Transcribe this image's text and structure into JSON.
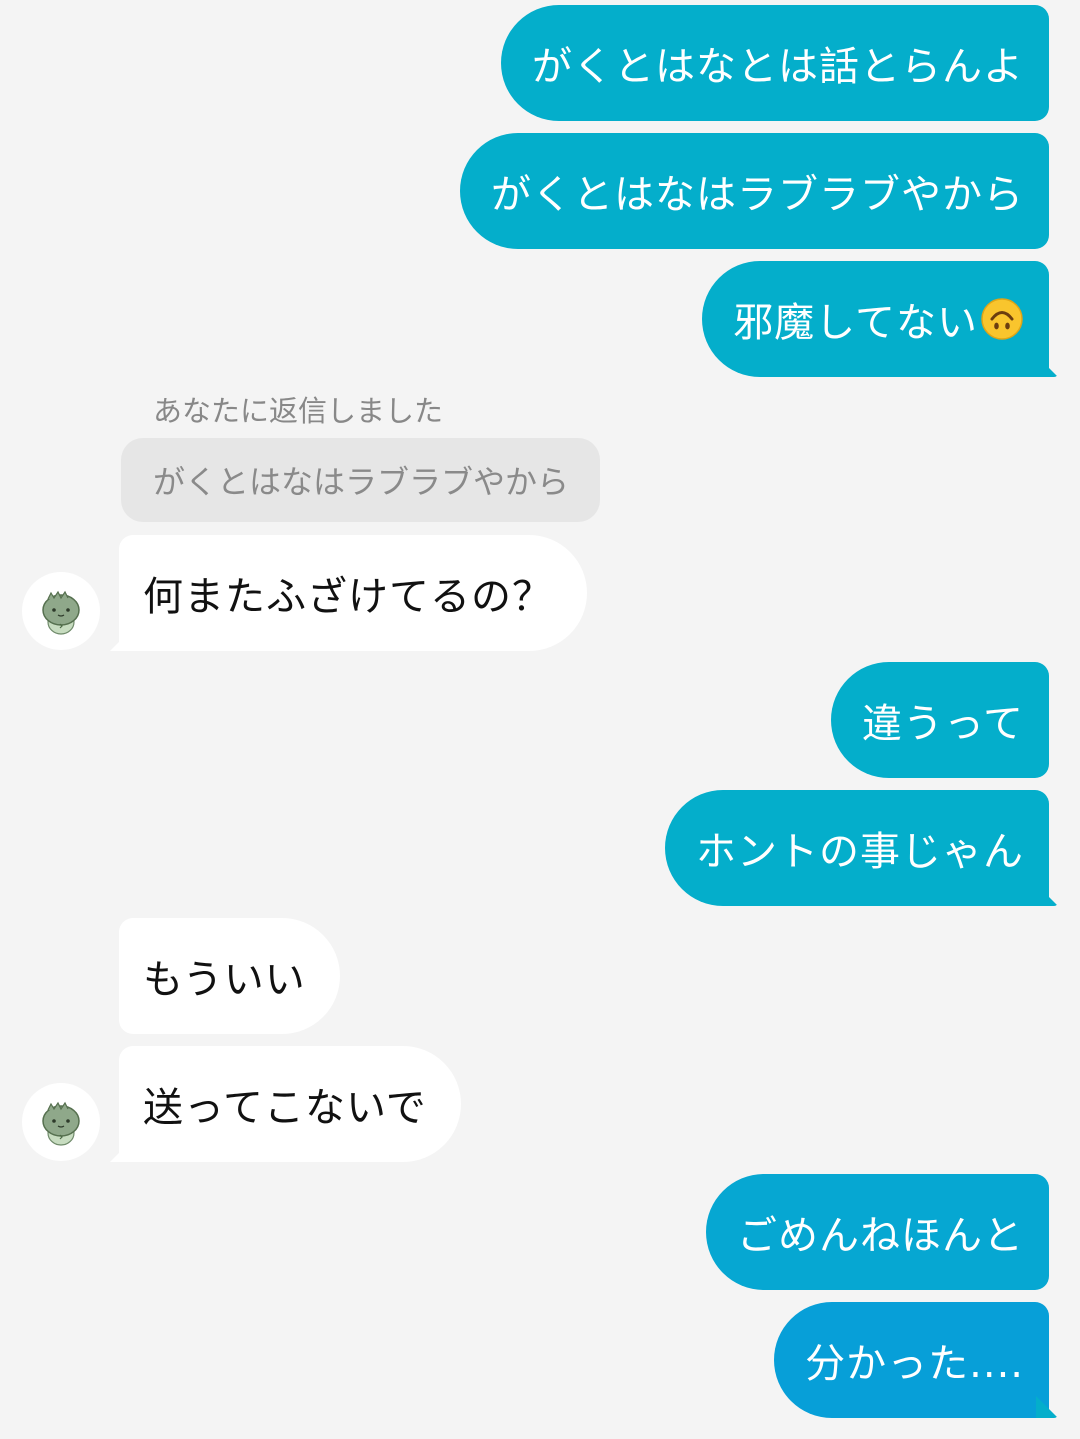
{
  "conversation": {
    "messages": [
      {
        "id": "m1",
        "side": "out",
        "text": "がくとはなとは話とらんよ"
      },
      {
        "id": "m2",
        "side": "out",
        "text": "がくとはなはラブラブやから"
      },
      {
        "id": "m3",
        "side": "out",
        "text": "邪魔してない",
        "emoji": "upside-down-face-icon"
      },
      {
        "id": "m4",
        "side": "in",
        "text": "何またふざけてるの？"
      },
      {
        "id": "m5",
        "side": "out",
        "text": "違うって"
      },
      {
        "id": "m6",
        "side": "out",
        "text": "ホントの事じゃん"
      },
      {
        "id": "m7",
        "side": "in",
        "text": "もういい"
      },
      {
        "id": "m8",
        "side": "in",
        "text": "送ってこないで"
      },
      {
        "id": "m9",
        "side": "out",
        "text": "ごめんねほんと"
      },
      {
        "id": "m10",
        "side": "out",
        "text": "分かった...."
      }
    ],
    "reply": {
      "label": "あなたに返信しました",
      "quoted_text": "がくとはなはラブラブやから"
    }
  },
  "colors": {
    "background": "#f4f4f4",
    "outgoing_bubble": "#04aecb",
    "incoming_bubble": "#ffffff",
    "quote_bubble": "#e6e6e6"
  },
  "avatar": {
    "icon": "green-dinosaur-character-avatar"
  }
}
